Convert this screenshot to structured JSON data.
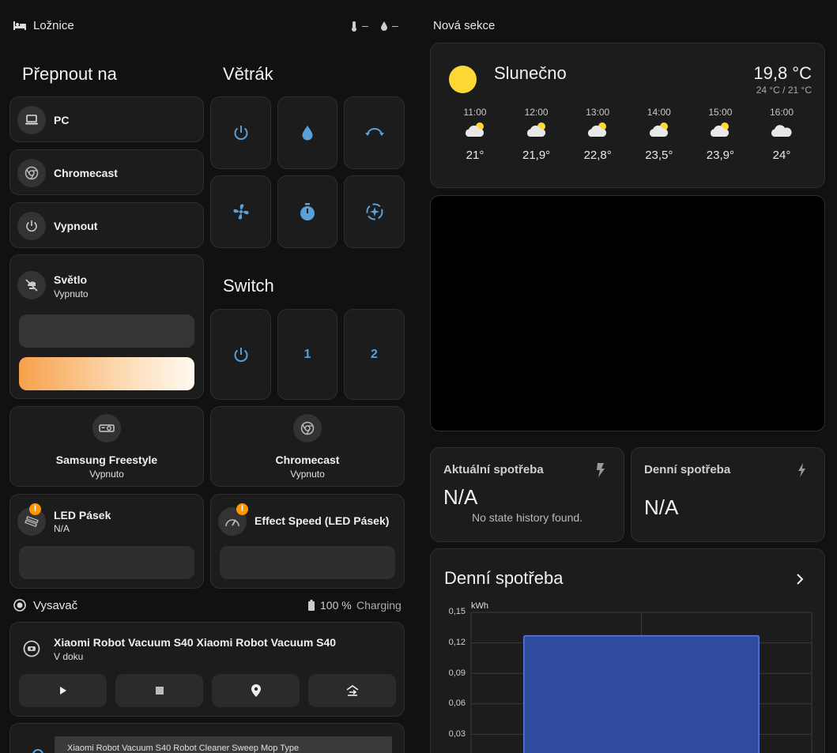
{
  "left_section": {
    "title": "Ložnice",
    "temp_value": "–",
    "humidity_value": "–"
  },
  "right_section": {
    "title": "Nová sekce"
  },
  "headings": {
    "switch_to": "Přepnout na",
    "fan": "Větrák",
    "switch": "Switch"
  },
  "tiles": {
    "pc": {
      "name": "PC"
    },
    "chromecast": {
      "name": "Chromecast"
    },
    "off": {
      "name": "Vypnout"
    },
    "light": {
      "name": "Světlo",
      "state": "Vypnuto"
    },
    "samsung": {
      "name": "Samsung Freestyle",
      "state": "Vypnuto"
    },
    "chromecast2": {
      "name": "Chromecast",
      "state": "Vypnuto"
    },
    "led": {
      "name": "LED Pásek",
      "state": "N/A"
    },
    "effect": {
      "name": "Effect Speed (LED Pásek)"
    }
  },
  "switch_buttons": {
    "b1": "1",
    "b2": "2"
  },
  "vacuum_section": {
    "title": "Vysavač",
    "battery": "100 %",
    "status": "Charging"
  },
  "vacuum": {
    "name": "Xiaomi Robot Vacuum S40 Xiaomi Robot Vacuum S40",
    "state": "V doku",
    "bottom_label": "Xiaomi Robot Vacuum S40 Robot Cleaner Sweep Mop Type"
  },
  "weather": {
    "condition": "Slunečno",
    "temperature": "19,8 °C",
    "high_low": "24 °C / 21 °C",
    "forecast": [
      {
        "time": "11:00",
        "temp": "21°"
      },
      {
        "time": "12:00",
        "temp": "21,9°"
      },
      {
        "time": "13:00",
        "temp": "22,8°"
      },
      {
        "time": "14:00",
        "temp": "23,5°"
      },
      {
        "time": "15:00",
        "temp": "23,9°"
      },
      {
        "time": "16:00",
        "temp": "24°"
      }
    ]
  },
  "energy": {
    "current": {
      "title": "Aktuální spotřeba",
      "value": "N/A",
      "note": "No state history found."
    },
    "daily": {
      "title": "Denní spotřeba",
      "value": "N/A"
    }
  },
  "daily_chart": {
    "title": "Denní spotřeba",
    "unit": "kWh",
    "yticks": [
      "0,15",
      "0,12",
      "0,09",
      "0,06",
      "0,03"
    ]
  },
  "chart_data": {
    "type": "bar",
    "title": "Denní spotřeba",
    "ylabel": "kWh",
    "ylim": [
      0,
      0.15
    ],
    "categories": [
      ""
    ],
    "values": [
      0.127
    ]
  },
  "colors": {
    "accent_blue": "#5aa0d8",
    "sun": "#fdd835",
    "warning": "#ff9800",
    "bar_fill": "#2f4a9e",
    "bar_edge": "#5b79e0"
  }
}
